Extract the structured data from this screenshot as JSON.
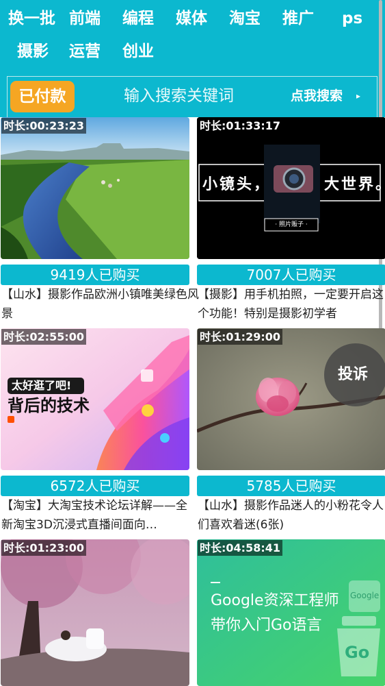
{
  "header": {
    "categories": [
      "换一批",
      "前端",
      "编程",
      "媒体",
      "淘宝",
      "推广",
      "ps",
      "摄影",
      "运营",
      "创业"
    ]
  },
  "search": {
    "paid_label": "已付款",
    "placeholder": "输入搜索关键词",
    "button_label": "点我搜索",
    "arrow": "▸"
  },
  "cards": [
    {
      "duration": "时长:00:23:23",
      "buyers": "9419人已购买",
      "title": "【山水】摄影作品欧洲小镇唯美绿色风景"
    },
    {
      "duration": "时长:01:33:17",
      "buyers": "7007人已购买",
      "title": "【摄影】用手机拍照，一定要开启这个功能！特别是摄影初学者",
      "thumb_text": {
        "left": "小镜头，",
        "right": "大世界。",
        "badge": "· 照片贩子 ·"
      }
    },
    {
      "duration": "时长:02:55:00",
      "buyers": "6572人已购买",
      "title": "【淘宝】大淘宝技术论坛详解——全新淘宝3D沉浸式直播间面向…",
      "thumb_text": {
        "line1": "太好逛了吧!",
        "line2": "背后的技术"
      }
    },
    {
      "duration": "时长:01:29:00",
      "buyers": "5785人已购买",
      "title": "【山水】摄影作品迷人的小粉花令人们喜欢着迷(6张)"
    },
    {
      "duration": "时长:01:23:00",
      "buyers": "",
      "title": ""
    },
    {
      "duration": "时长:04:58:41",
      "buyers": "",
      "title": "",
      "thumb_text": {
        "line1": "Google资深工程师",
        "line2": "带你入门Go语言",
        "logo": "Google",
        "go": "Go"
      }
    }
  ],
  "report": {
    "label": "投诉"
  }
}
